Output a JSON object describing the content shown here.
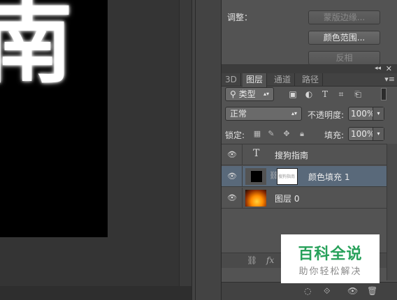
{
  "canvas": {
    "text": "南"
  },
  "properties": {
    "label": "调整：",
    "buttons": [
      {
        "label": "蒙版边缘...",
        "enabled": false
      },
      {
        "label": "颜色范围...",
        "enabled": true
      },
      {
        "label": "反相",
        "enabled": false
      }
    ]
  },
  "layers_panel": {
    "tabs": [
      "3D",
      "图层",
      "通道",
      "路径"
    ],
    "active_tab": "图层",
    "filter_kind": "类型",
    "blend_mode": "正常",
    "opacity_label": "不透明度:",
    "opacity_value": "100%",
    "lock_label": "锁定:",
    "fill_label": "填充:",
    "fill_value": "100%",
    "layers": [
      {
        "name": "搜狗指南",
        "type": "text",
        "visible": true,
        "selected": false
      },
      {
        "name": "颜色填充 1",
        "type": "fill",
        "mask_text": "搜狗指南",
        "visible": true,
        "selected": true
      },
      {
        "name": "图层 0",
        "type": "pixel",
        "visible": true,
        "selected": false
      }
    ],
    "footer_icons": [
      "link-icon",
      "fx-icon",
      "mask-icon",
      "adjustment-icon",
      "folder-icon",
      "new-layer-icon",
      "trash-icon"
    ]
  },
  "watermark": {
    "title": "百科全说",
    "subtitle": "助你轻松解决"
  },
  "colors": {
    "selected_row": "#59697a",
    "watermark_green": "#27a15a"
  }
}
